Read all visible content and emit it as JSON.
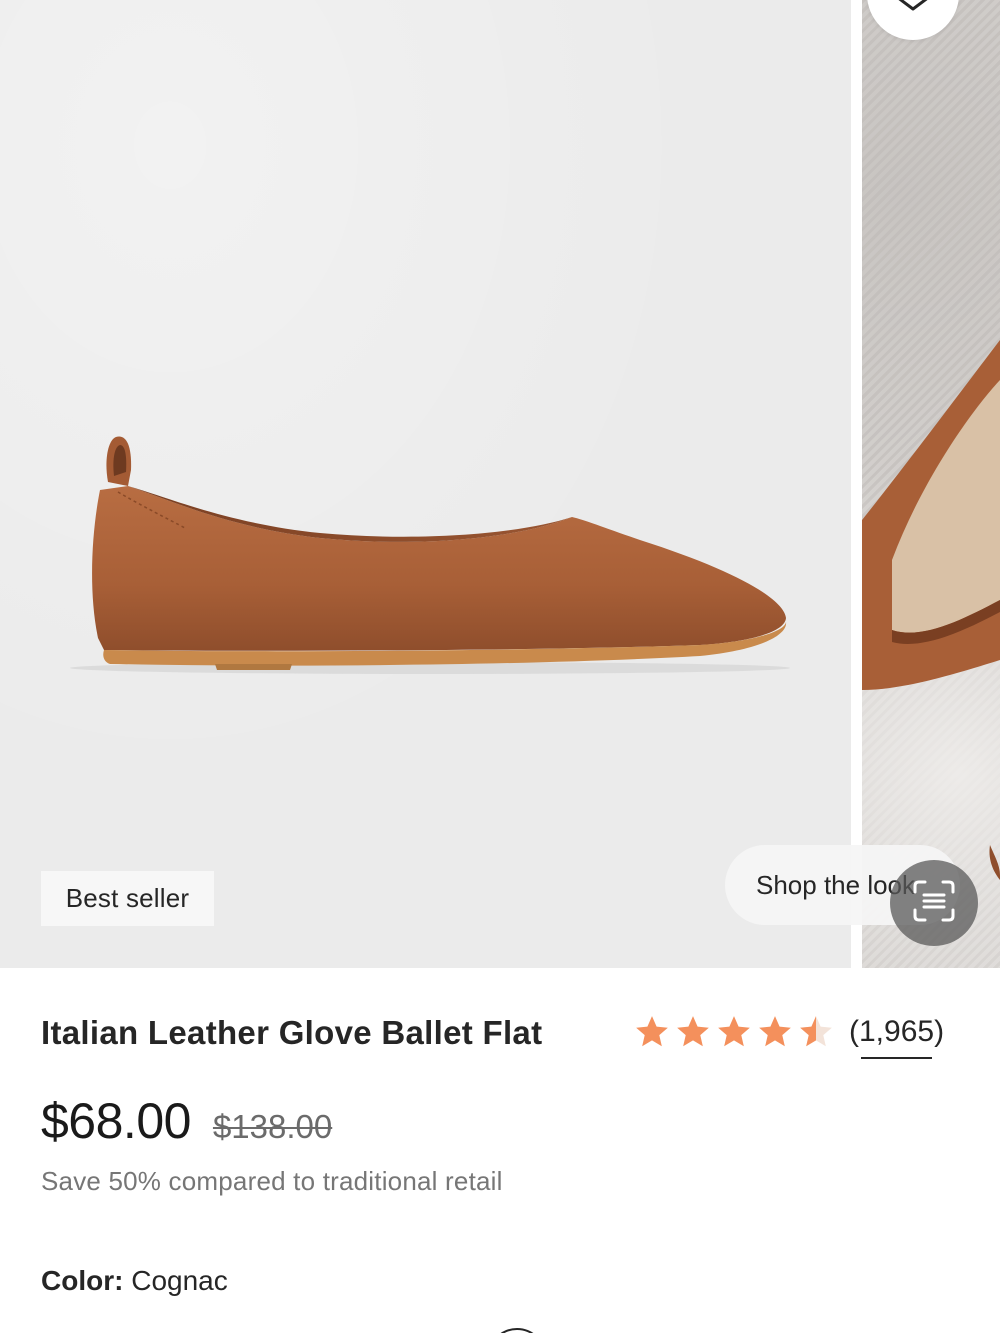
{
  "gallery": {
    "badge": "Best seller",
    "shop_the_look": "Shop the look",
    "icons": {
      "wishlist": "heart-icon",
      "scan": "visual-search-icon"
    }
  },
  "product": {
    "title": "Italian Leather Glove Ballet Flat",
    "rating": {
      "stars": 4.5,
      "max": 5,
      "count_label": "(1,965)",
      "star_color": "#f4905c"
    },
    "price": "$68.00",
    "original_price": "$138.00",
    "savings": "Save 50% compared to traditional retail",
    "color": {
      "label": "Color:",
      "value": "Cognac"
    }
  },
  "colors": {
    "shoe": "#b0663d",
    "sole": "#c98a4c",
    "gallery_bg": "#ebebeb"
  }
}
